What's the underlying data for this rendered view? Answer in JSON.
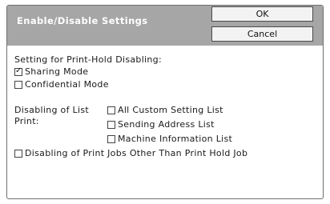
{
  "dialog": {
    "title": "Enable/Disable Settings",
    "ok_label": "OK",
    "cancel_label": "Cancel"
  },
  "print_hold": {
    "heading": "Setting for Print-Hold Disabling:",
    "options": [
      {
        "label": "Sharing Mode",
        "checked": true
      },
      {
        "label": "Confidential Mode",
        "checked": false
      }
    ]
  },
  "list_print": {
    "heading_line1": "Disabling of List",
    "heading_line2": "Print:",
    "options": [
      {
        "label": "All Custom Setting List",
        "checked": false
      },
      {
        "label": "Sending Address List",
        "checked": false
      },
      {
        "label": "Machine Information List",
        "checked": false
      }
    ]
  },
  "print_jobs": {
    "label": "Disabling of Print Jobs Other Than Print Hold Job",
    "checked": false
  },
  "check_glyph": "✓"
}
